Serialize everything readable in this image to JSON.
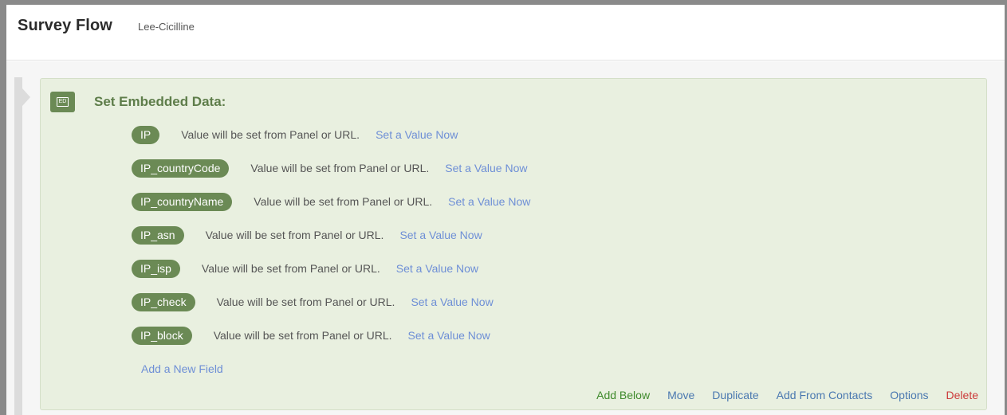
{
  "header": {
    "title": "Survey Flow",
    "subtitle": "Lee-Cicilline"
  },
  "block": {
    "badge": "ED",
    "title": "Set Embedded Data:",
    "fields": [
      {
        "name": "IP",
        "description": "Value will be set from Panel or URL.",
        "link": "Set a Value Now"
      },
      {
        "name": "IP_countryCode",
        "description": "Value will be set from Panel or URL.",
        "link": "Set a Value Now"
      },
      {
        "name": "IP_countryName",
        "description": "Value will be set from Panel or URL.",
        "link": "Set a Value Now"
      },
      {
        "name": "IP_asn",
        "description": "Value will be set from Panel or URL.",
        "link": "Set a Value Now"
      },
      {
        "name": "IP_isp",
        "description": "Value will be set from Panel or URL.",
        "link": "Set a Value Now"
      },
      {
        "name": "IP_check",
        "description": "Value will be set from Panel or URL.",
        "link": "Set a Value Now"
      },
      {
        "name": "IP_block",
        "description": "Value will be set from Panel or URL.",
        "link": "Set a Value Now"
      }
    ],
    "add_field_label": "Add a New Field",
    "actions": {
      "add_below": "Add Below",
      "move": "Move",
      "duplicate": "Duplicate",
      "add_from_contacts": "Add From Contacts",
      "options": "Options",
      "delete": "Delete"
    }
  },
  "colors": {
    "accent_green": "#6b8a55",
    "block_background": "#e9f0e0",
    "link_blue": "#6e8fd6",
    "action_blue": "#4a78b0",
    "delete_red": "#cc3a3a",
    "add_green": "#3f8a2c"
  }
}
